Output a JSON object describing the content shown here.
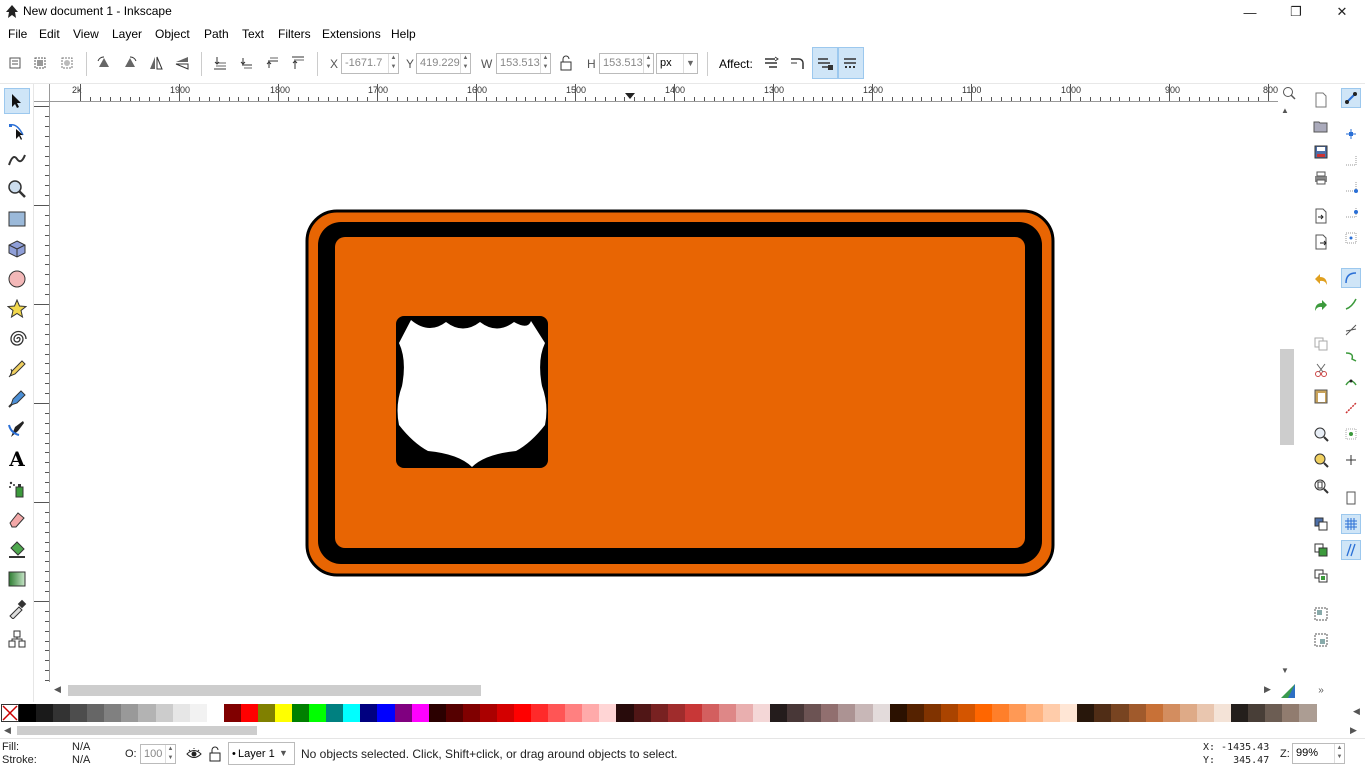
{
  "window": {
    "title": "New document 1 - Inkscape",
    "controls": [
      "minimize-icon",
      "restore-icon",
      "close-icon"
    ]
  },
  "menubar": {
    "items": [
      "File",
      "Edit",
      "View",
      "Layer",
      "Object",
      "Path",
      "Text",
      "Filters",
      "Extensions",
      "Help"
    ]
  },
  "toolbar": {
    "x_label": "X",
    "x_value": "-1671.7",
    "y_label": "Y",
    "y_value": "419.229",
    "w_label": "W",
    "w_value": "153.513",
    "h_label": "H",
    "h_value": "153.513",
    "unit": "px",
    "affect_label": "Affect:",
    "lock_icon": "lock-icon"
  },
  "ruler": {
    "top_labels": [
      "2k",
      "1900",
      "1800",
      "1700",
      "1600",
      "1500",
      "1400",
      "1300",
      "1200",
      "1100",
      "1000",
      "900",
      "800"
    ]
  },
  "colors": {
    "sign_orange": "#e86503",
    "sign_black": "#000000",
    "shield_white": "#ffffff",
    "accent": "#3c8ee0"
  },
  "tools": [
    "selector-tool-icon",
    "node-tool-icon",
    "tweak-tool-icon",
    "zoom-tool-icon",
    "rectangle-tool-icon",
    "3dbox-tool-icon",
    "ellipse-tool-icon",
    "star-tool-icon",
    "spiral-tool-icon",
    "pencil-tool-icon",
    "pen-tool-icon",
    "calligraphy-tool-icon",
    "text-tool-icon",
    "spray-tool-icon",
    "eraser-tool-icon",
    "paint-bucket-tool-icon",
    "gradient-tool-icon",
    "dropper-tool-icon",
    "connector-tool-icon"
  ],
  "palette": {
    "colors": [
      "#000000",
      "#1a1a1a",
      "#333333",
      "#4d4d4d",
      "#666666",
      "#808080",
      "#999999",
      "#b3b3b3",
      "#cccccc",
      "#e6e6e6",
      "#f2f2f2",
      "#ffffff",
      "#800000",
      "#ff0000",
      "#808000",
      "#ffff00",
      "#008000",
      "#00ff00",
      "#008080",
      "#00ffff",
      "#000080",
      "#0000ff",
      "#800080",
      "#ff00ff",
      "#2b0000",
      "#550000",
      "#800000",
      "#aa0000",
      "#d40000",
      "#ff0000",
      "#ff2a2a",
      "#ff5555",
      "#ff8080",
      "#ffaaaa",
      "#ffd5d5",
      "#280b0b",
      "#501616",
      "#782121",
      "#a02c2c",
      "#c83737",
      "#d35f5f",
      "#de8787",
      "#e9afaf",
      "#f4d7d7",
      "#241c1c",
      "#483737",
      "#6c5353",
      "#916f6f",
      "#ac9393",
      "#c8b7b7",
      "#e3dbdb",
      "#2b1100",
      "#552200",
      "#803300",
      "#aa4400",
      "#d45500",
      "#ff6600",
      "#ff7f2a",
      "#ff9955",
      "#ffb380",
      "#ffccaa",
      "#ffe6d5",
      "#28170b",
      "#502d16",
      "#784421",
      "#a05a2c",
      "#c87137",
      "#d38d5f",
      "#deaa87",
      "#e9c6af",
      "#f4e3d7",
      "#241f1c",
      "#483e37",
      "#6c5d53",
      "#917c6f",
      "#ac9d93"
    ]
  },
  "status": {
    "fill_label": "Fill:",
    "fill_value": "N/A",
    "stroke_label": "Stroke:",
    "stroke_value": "N/A",
    "opacity_label": "O:",
    "opacity_value": "100",
    "layer_name": "Layer 1",
    "message": "No objects selected. Click, Shift+click, or drag around objects to select.",
    "cursor_x": "X: -1435.43",
    "cursor_y": "Y:   345.47",
    "zoom_label": "Z:",
    "zoom_value": "99%"
  }
}
